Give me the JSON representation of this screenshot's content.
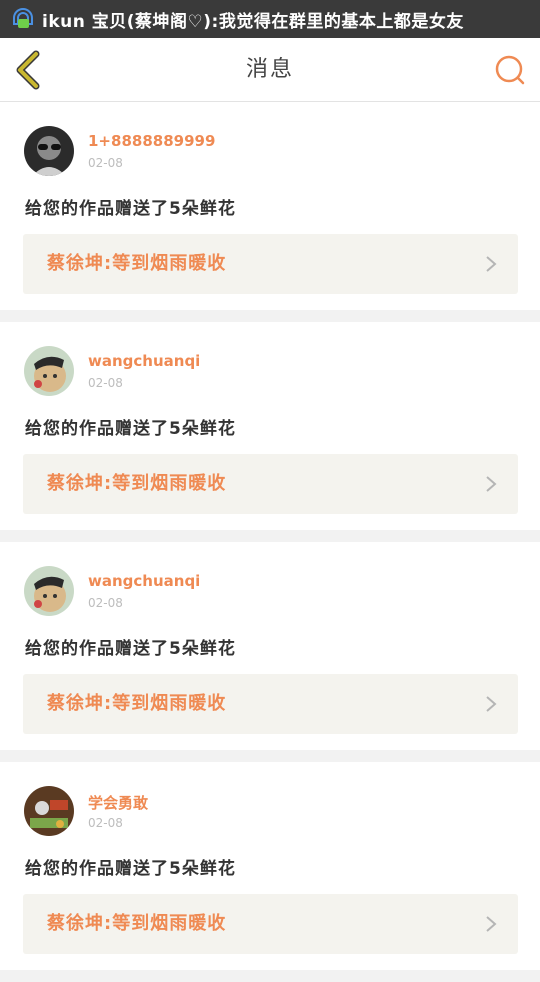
{
  "status_bar": {
    "notification_text": "ikun 宝贝(蔡坤阁♡):我觉得在群里的基本上都是女友",
    "app_icon": "chat-bubble-icon"
  },
  "nav": {
    "title": "消息",
    "back_icon": "chevron-left-icon",
    "search_icon": "search-icon",
    "accent_color": "#ef8a53",
    "back_color": "#c9b830"
  },
  "messages": [
    {
      "username": "1+8888889999",
      "date": "02-08",
      "text": "给您的作品赠送了5朵鲜花",
      "work_title": "蔡徐坤:等到烟雨暖收",
      "avatar": "avatar-bw-photo"
    },
    {
      "username": "wangchuanqi",
      "date": "02-08",
      "text": "给您的作品赠送了5朵鲜花",
      "work_title": "蔡徐坤:等到烟雨暖收",
      "avatar": "avatar-cat-photo"
    },
    {
      "username": "wangchuanqi",
      "date": "02-08",
      "text": "给您的作品赠送了5朵鲜花",
      "work_title": "蔡徐坤:等到烟雨暖收",
      "avatar": "avatar-cat-photo"
    },
    {
      "username": "学会勇敢",
      "date": "02-08",
      "text": "给您的作品赠送了5朵鲜花",
      "work_title": "蔡徐坤:等到烟雨暖收",
      "avatar": "avatar-food-photo"
    }
  ]
}
